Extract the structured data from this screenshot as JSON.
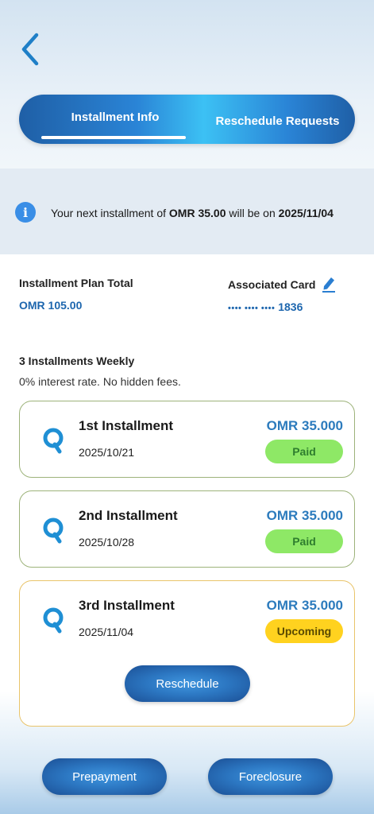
{
  "header": {
    "tabs": [
      {
        "label": "Installment Info",
        "active": true
      },
      {
        "label": "Reschedule Requests",
        "active": false
      }
    ]
  },
  "banner": {
    "text_prefix": "Your next installment of ",
    "amount": "OMR 35.00",
    "text_middle": " will be on ",
    "date": "2025/11/04"
  },
  "plan": {
    "total_label": "Installment Plan Total",
    "total_value": "OMR 105.00",
    "card_label": "Associated Card",
    "card_dots": "•••• •••• ••••",
    "card_last4": "1836",
    "weekly_title": "3 Installments Weekly",
    "weekly_subtitle": "0% interest rate. No hidden fees."
  },
  "installments": [
    {
      "name": "1st Installment",
      "date": "2025/10/21",
      "amount": "OMR 35.000",
      "status": "Paid"
    },
    {
      "name": "2nd Installment",
      "date": "2025/10/28",
      "amount": "OMR 35.000",
      "status": "Paid"
    },
    {
      "name": "3rd Installment",
      "date": "2025/11/04",
      "amount": "OMR 35.000",
      "status": "Upcoming"
    }
  ],
  "buttons": {
    "reschedule": "Reschedule",
    "prepayment": "Prepayment",
    "foreclosure": "Foreclosure"
  },
  "colors": {
    "accent_blue": "#1d66ae",
    "paid_badge": "#8ee866",
    "upcoming_badge": "#ffd21f"
  },
  "icons": {
    "back": "chevron-left-icon",
    "info": "info-icon",
    "edit": "pencil-icon",
    "installment": "q-logo-icon"
  }
}
